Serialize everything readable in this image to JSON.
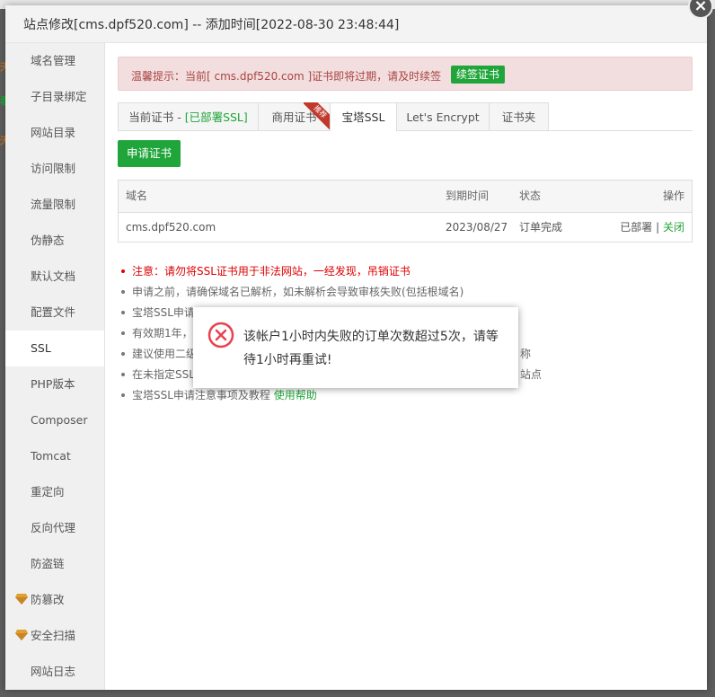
{
  "dialog": {
    "title": "站点修改[cms.dpf520.com] -- 添加时间[2022-08-30 23:48:44]",
    "close_glyph": "×"
  },
  "background": {
    "left_chars": [
      "天",
      "看",
      "天"
    ]
  },
  "sidebar": {
    "items": [
      {
        "label": "域名管理"
      },
      {
        "label": "子目录绑定"
      },
      {
        "label": "网站目录"
      },
      {
        "label": "访问限制"
      },
      {
        "label": "流量限制"
      },
      {
        "label": "伪静态"
      },
      {
        "label": "默认文档"
      },
      {
        "label": "配置文件"
      },
      {
        "label": "SSL",
        "active": true
      },
      {
        "label": "PHP版本"
      },
      {
        "label": "Composer"
      },
      {
        "label": "Tomcat"
      },
      {
        "label": "重定向"
      },
      {
        "label": "反向代理"
      },
      {
        "label": "防盗链"
      },
      {
        "label": "防篡改",
        "icon": "gem-icon"
      },
      {
        "label": "安全扫描",
        "icon": "gem-icon"
      },
      {
        "label": "网站日志"
      }
    ]
  },
  "alert": {
    "text": "温馨提示：当前[ cms.dpf520.com ]证书即将过期，请及时续签",
    "renew_button": "续签证书"
  },
  "tabs": {
    "current_prefix": "当前证书 - ",
    "current_status": "[已部署SSL]",
    "commercial": "商用证书",
    "commercial_badge": "推荐",
    "baota": "宝塔SSL",
    "letsencrypt": "Let's Encrypt",
    "folder": "证书夹"
  },
  "apply_button": "申请证书",
  "table": {
    "headers": {
      "domain": "域名",
      "expire": "到期时间",
      "status": "状态",
      "action": "操作"
    },
    "rows": [
      {
        "domain": "cms.dpf520.com",
        "expire": "2023/08/27",
        "status": "订单完成",
        "deployed": "已部署",
        "sep": " | ",
        "close": "关闭"
      }
    ]
  },
  "tips": {
    "warning": "注意：请勿将SSL证书用于非法网站，一经发现，吊销证书",
    "t2": "申请之前，请确保域名已解析，如未解析会导致审核失败(包括根域名)",
    "t3": "宝塔SSL申请",
    "t4": "有效期1年，",
    "t5": "建议使用二级",
    "t5_tail": "称",
    "t6": "在未指定SSL",
    "t6_tail": "站点",
    "t7": "宝塔SSL申请注意事项及教程 ",
    "t7_link": "使用帮助"
  },
  "message": {
    "text": "该帐户1小时内失败的订单次数超过5次，请等待1小时再重试!",
    "icon": "error-icon"
  },
  "colors": {
    "accent": "#20a53a",
    "alert_bg": "#f2dede",
    "alert_text": "#a94442",
    "error": "#e9424e"
  }
}
